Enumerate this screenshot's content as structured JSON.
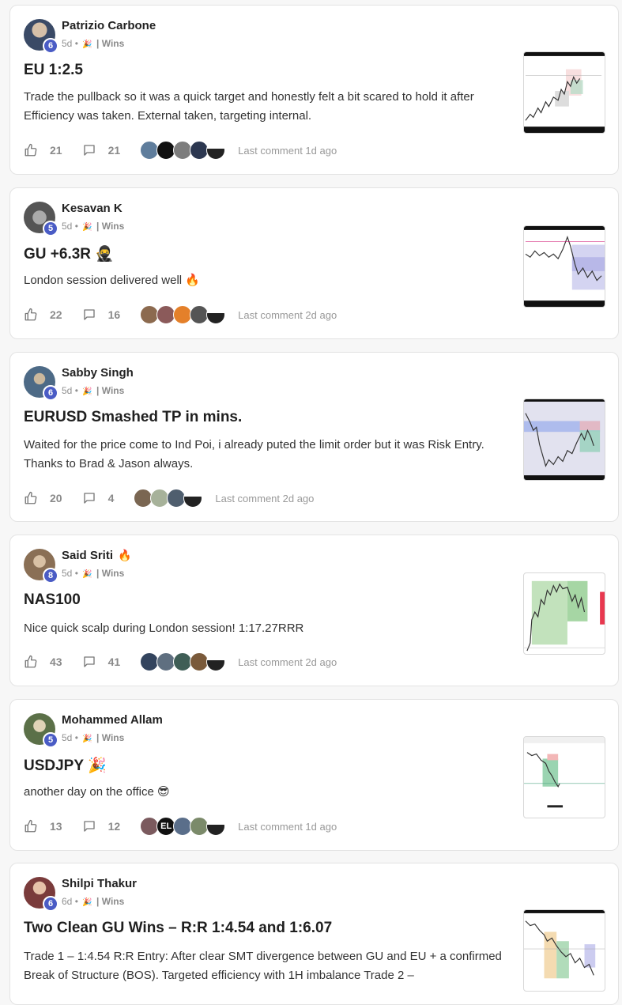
{
  "posts": [
    {
      "author": "Patrizio Carbone",
      "level": "6",
      "age": "5d",
      "category": "| Wins",
      "title": "EU 1:2.5",
      "body": "Trade the pullback so it was a quick target and honestly felt a bit scared to hold it after Efficiency was taken. External taken, targeting internal.",
      "likes": "21",
      "comments": "21",
      "last_comment": "Last comment 1d ago",
      "avatar_color": "#3a4a66",
      "commenter_colors": [
        "#5f7d9c",
        "#111111",
        "#7d7d7d",
        "#2c3750",
        "#e8e8e8"
      ]
    },
    {
      "author": "Kesavan K",
      "level": "5",
      "age": "5d",
      "category": "| Wins",
      "title": "GU +6.3R 🥷",
      "body": "London session delivered well 🔥",
      "likes": "22",
      "comments": "16",
      "last_comment": "Last comment 2d ago",
      "avatar_color": "#6b6b6b",
      "commenter_colors": [
        "#8c6a4f",
        "#8b5a5a",
        "#e4802a",
        "#555555",
        "#e8e8e8"
      ]
    },
    {
      "author": "Sabby Singh",
      "level": "6",
      "age": "5d",
      "category": "| Wins",
      "title": "EURUSD Smashed TP in mins.",
      "body": "Waited for the price come to Ind Poi, i already puted the limit order but it was Risk Entry. Thanks to Brad & Jason always.",
      "likes": "20",
      "comments": "4",
      "last_comment": "Last comment 2d ago",
      "avatar_color": "#4d6a86",
      "commenter_colors": [
        "#7a6652",
        "#a7b29a",
        "#4f5e6e",
        "#e8e8e8"
      ]
    },
    {
      "author": "Said Sriti",
      "author_flame": "🔥",
      "level": "8",
      "age": "5d",
      "category": "| Wins",
      "title": "NAS100",
      "body": "Nice quick scalp during London session! 1:17.27RRR",
      "likes": "43",
      "comments": "41",
      "last_comment": "Last comment 2d ago",
      "avatar_color": "#8a6f55",
      "commenter_colors": [
        "#33445e",
        "#5f6f80",
        "#3f5e56",
        "#7a5a3a",
        "#e8e8e8"
      ]
    },
    {
      "author": "Mohammed Allam",
      "level": "5",
      "age": "5d",
      "category": "| Wins",
      "title": "USDJPY 🎉",
      "body": "another day on the office 😎",
      "likes": "13",
      "comments": "12",
      "last_comment": "Last comment 1d ago",
      "avatar_color": "#5b7048",
      "commenter_colors": [
        "#7b5a5e",
        "#111111",
        "#5a6e8a",
        "#7b8a6a",
        "#e8e8e8"
      ],
      "badge_letter": "EL"
    },
    {
      "author": "Shilpi Thakur",
      "level": "6",
      "age": "6d",
      "category": "| Wins",
      "title": "Two Clean GU Wins – R:R 1:4.54 and 1:6.07",
      "body": "Trade 1 – 1:4.54 R:R Entry: After clear SMT divergence between GU and EU + a confirmed Break of Structure (BOS). Targeted efficiency with 1H imbalance Trade 2 –",
      "likes": "",
      "comments": "",
      "last_comment": "",
      "avatar_color": "#7a3b3b",
      "commenter_colors": []
    }
  ],
  "icons": {
    "like": "thumbs-up-icon",
    "comment": "comment-bubble-icon",
    "category": "party-popper-icon"
  }
}
